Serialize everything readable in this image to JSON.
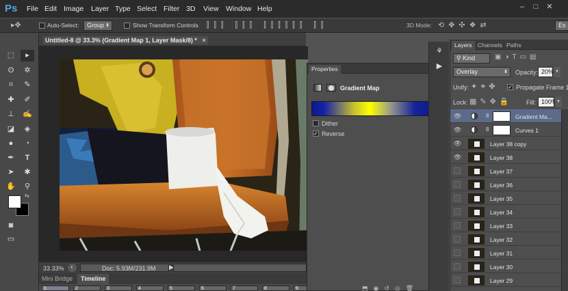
{
  "app": {
    "logo": "Ps"
  },
  "menu": [
    "File",
    "Edit",
    "Image",
    "Layer",
    "Type",
    "Select",
    "Filter",
    "3D",
    "View",
    "Window",
    "Help"
  ],
  "options": {
    "auto_select_label": "Auto-Select:",
    "auto_select_value": "Group",
    "transform_label": "Show Transform Controls",
    "mode_3d_label": "3D Mode:",
    "workspace": "Es"
  },
  "document": {
    "tab_title": "Untitled-8 @ 33.3% (Gradient Map 1, Layer Mask/8) *",
    "close": "×"
  },
  "status": {
    "zoom": "33.33%",
    "doc_info": "Doc: 5.93M/231.9M"
  },
  "bottom_tabs": [
    "Mini Bridge",
    "Timeline"
  ],
  "timeline_frames": [
    "1",
    "2",
    "3",
    "4",
    "5",
    "6",
    "7",
    "8",
    "9"
  ],
  "properties": {
    "tab": "Properties",
    "title": "Gradient Map",
    "dither_label": "Dither",
    "reverse_label": "Reverse",
    "dither_checked": false,
    "reverse_checked": true,
    "gradient_colors": [
      "#0a1a8c",
      "#ffff00",
      "#9a9a8a",
      "#0a1a8c"
    ]
  },
  "layers_panel": {
    "tabs": [
      "Layers",
      "Channels",
      "Paths"
    ],
    "kind_label": "Kind",
    "blend_mode": "Overlay",
    "opacity_label": "Opacity:",
    "opacity": "20%",
    "unify_label": "Unify:",
    "propagate_label": "Propagate Frame 1",
    "lock_label": "Lock:",
    "fill_label": "Fill:",
    "fill": "100%",
    "layers": [
      {
        "name": "Gradient Ma...",
        "type": "adjustment",
        "visible": true,
        "selected": true
      },
      {
        "name": "Curves 1",
        "type": "adjustment",
        "visible": true,
        "selected": false
      },
      {
        "name": "Layer 38 copy",
        "type": "pixel",
        "visible": true,
        "selected": false
      },
      {
        "name": "Layer 38",
        "type": "pixel",
        "visible": true,
        "selected": false
      },
      {
        "name": "Layer 37",
        "type": "pixel",
        "visible": false,
        "selected": false
      },
      {
        "name": "Layer 36",
        "type": "pixel",
        "visible": false,
        "selected": false
      },
      {
        "name": "Layer 35",
        "type": "pixel",
        "visible": false,
        "selected": false
      },
      {
        "name": "Layer 34",
        "type": "pixel",
        "visible": false,
        "selected": false
      },
      {
        "name": "Layer 33",
        "type": "pixel",
        "visible": false,
        "selected": false
      },
      {
        "name": "Layer 32",
        "type": "pixel",
        "visible": false,
        "selected": false
      },
      {
        "name": "Layer 31",
        "type": "pixel",
        "visible": false,
        "selected": false
      },
      {
        "name": "Layer 30",
        "type": "pixel",
        "visible": false,
        "selected": false
      },
      {
        "name": "Layer 29",
        "type": "pixel",
        "visible": false,
        "selected": false
      }
    ]
  }
}
